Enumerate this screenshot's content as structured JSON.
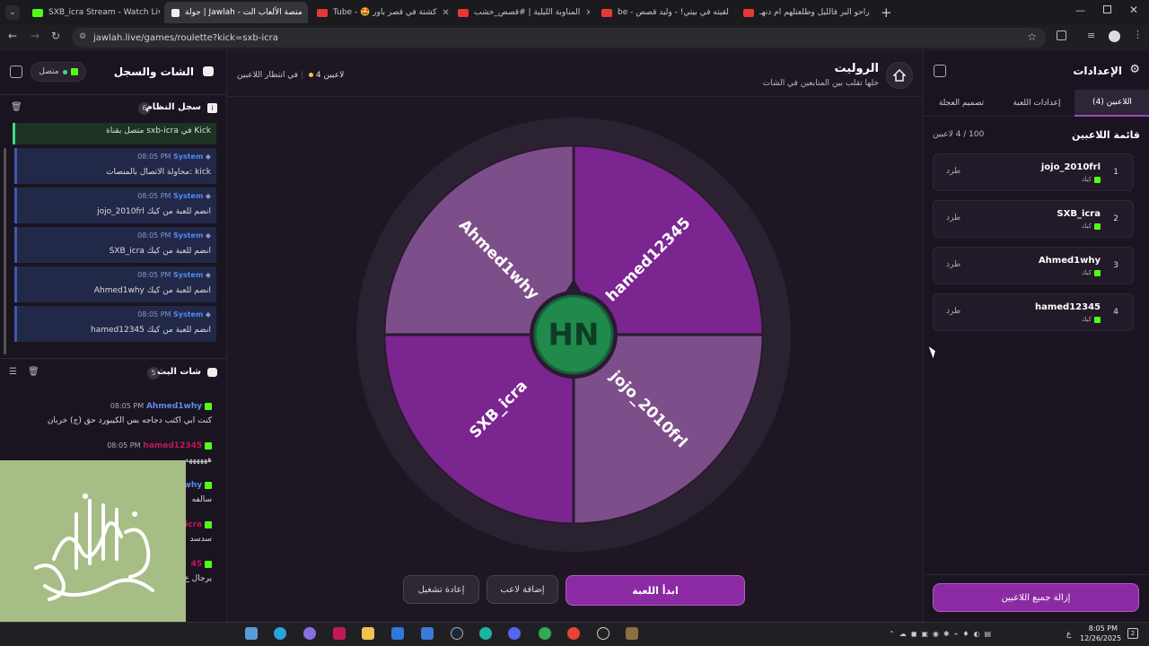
{
  "browser": {
    "tabs": [
      {
        "label": "SXB_icra Stream - Watch Live o"
      },
      {
        "label": "جولة | Jawlah - منصة الألعاب الت"
      },
      {
        "label": "Tube - 🤩 كشتة في قصر باور"
      },
      {
        "label": "المناوبة الليلية | #قصص_خشب"
      },
      {
        "label": "be - لقيته في بيتي! - وليد قصص"
      },
      {
        "label": "راحو البر فالليل وطلعتلهم ام دنهـ"
      }
    ],
    "url": "jawlah.live/games/roulette?kick=sxb-icra"
  },
  "left": {
    "title": "الشات والسجل",
    "status": "متصل",
    "system_log": {
      "title": "سجل النظام",
      "count": "6",
      "first": "متصل بقناة sxb-icra في Kick"
    },
    "messages": [
      {
        "sender": "System",
        "time": "08:05 PM",
        "text": "محاولة الاتصال بالمنصات: kick"
      },
      {
        "sender": "System",
        "time": "08:05 PM",
        "text": "jojo_2010frl انضم للعبة من كيك"
      },
      {
        "sender": "System",
        "time": "08:05 PM",
        "text": "SXB_icra انضم للعبة من كيك"
      },
      {
        "sender": "System",
        "time": "08:05 PM",
        "text": "Ahmed1why انضم للعبة من كيك"
      },
      {
        "sender": "System",
        "time": "08:05 PM",
        "text": "hamed12345 انضم للعبة من كيك"
      }
    ],
    "stream_chat": {
      "title": "شات البث",
      "count": "5"
    },
    "chat": [
      {
        "user": "Ahmed1why",
        "time": "08:05 PM",
        "text": "كنت ابي اكتب دجاجه بس الكيبورد حق (ج) خربان"
      },
      {
        "user": "hamed12345",
        "time": "08:05 PM",
        "text": "ههههههه"
      },
      {
        "user": "why",
        "time": "",
        "text": "سالفه"
      },
      {
        "user": "icra",
        "time": "",
        "text": "سدسد"
      },
      {
        "user": "45",
        "time": "",
        "text": "يرجال ع"
      }
    ],
    "calligraphy": "صلى الله عليه وسلم"
  },
  "center": {
    "title": "الروليت",
    "subtitle": "خلها تقلب بين المتابعين في الشات",
    "players_count": "4 لاعبين",
    "waiting": "في انتظار اللاعبين",
    "wheel": {
      "segments": [
        "Ahmed1why",
        "hamed12345",
        "SXB_icra",
        "jojo_2010frl"
      ],
      "colors": [
        "#7d4f8a",
        "#7a2590",
        "#7a2590",
        "#7d4f8a"
      ],
      "logo": "HN"
    },
    "buttons": {
      "start": "ابدأ اللعبة",
      "add": "إضافة لاعب",
      "restart": "إعادة تشغيل"
    }
  },
  "right": {
    "title": "الإعدادات",
    "tabs": [
      "اللاعبين (4)",
      "إعدادات اللعبة",
      "تصميم العجلة"
    ],
    "list_title": "قائمة اللاعبين",
    "capacity": "100 / 4 لاعبين",
    "players": [
      {
        "num": "1",
        "name": "jojo_2010frl",
        "platform": "كيك",
        "kick": "طرد"
      },
      {
        "num": "2",
        "name": "SXB_icra",
        "platform": "كيك",
        "kick": "طرد"
      },
      {
        "num": "3",
        "name": "Ahmed1why",
        "platform": "كيك",
        "kick": "طرد"
      },
      {
        "num": "4",
        "name": "hamed12345",
        "platform": "كيك",
        "kick": "طرد"
      }
    ],
    "remove_all": "إزالة جميع اللاعبين"
  },
  "taskbar": {
    "time": "8:05 PM",
    "date": "12/26/2025",
    "lang": "ع"
  }
}
